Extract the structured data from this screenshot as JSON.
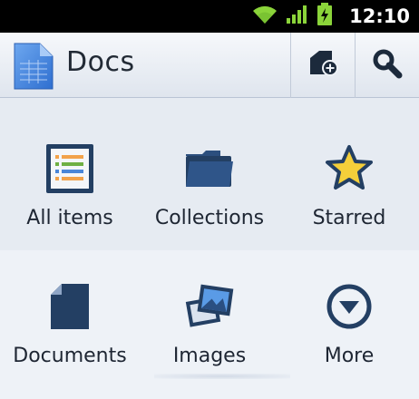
{
  "status_bar": {
    "time": "12:10",
    "icons": [
      "wifi-icon",
      "signal-icon",
      "battery-charging-icon"
    ]
  },
  "action_bar": {
    "title": "Docs",
    "logo_icon": "docs-logo-icon",
    "actions": [
      {
        "name": "new-document",
        "icon": "new-document-icon"
      },
      {
        "name": "search",
        "icon": "search-icon"
      }
    ]
  },
  "grid": {
    "items": [
      {
        "label": "All items",
        "icon": "list-icon"
      },
      {
        "label": "Collections",
        "icon": "folder-icon"
      },
      {
        "label": "Starred",
        "icon": "star-icon"
      },
      {
        "label": "Documents",
        "icon": "document-icon"
      },
      {
        "label": "Images",
        "icon": "images-icon"
      },
      {
        "label": "More",
        "icon": "more-dropdown-icon"
      }
    ]
  },
  "colors": {
    "accent": "#233f63",
    "status_bar": "#000000",
    "signal_green": "#8bd43a",
    "star_yellow": "#f4cf3a",
    "background": "#e7ecf3"
  }
}
